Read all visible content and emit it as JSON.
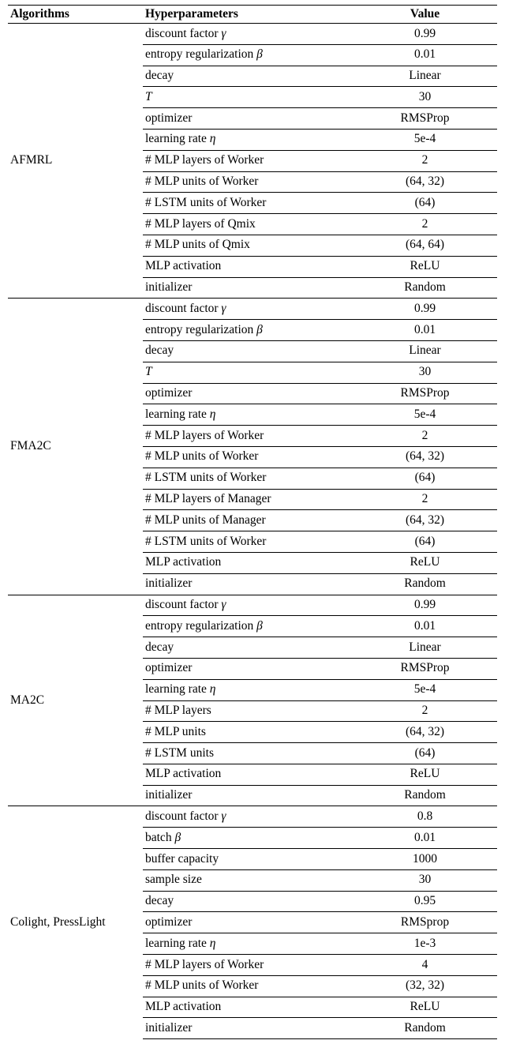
{
  "headers": {
    "alg": "Algorithms",
    "param": "Hyperparameters",
    "value": "Value"
  },
  "groups": [
    {
      "alg": "AFMRL",
      "rows": [
        {
          "param_html": "discount factor <span class='sym'>γ</span>",
          "value": "0.99"
        },
        {
          "param_html": "entropy regularization <span class='sym'>β</span>",
          "value": "0.01"
        },
        {
          "param_html": "decay",
          "value": "Linear"
        },
        {
          "param_html": "<span class='sym'>T</span>",
          "value": "30"
        },
        {
          "param_html": "optimizer",
          "value": "RMSProp"
        },
        {
          "param_html": "learning rate <span class='sym'>η</span>",
          "value": "5e-4"
        },
        {
          "param_html": "# MLP layers of Worker",
          "value": "2"
        },
        {
          "param_html": "# MLP units of Worker",
          "value": "(64, 32)"
        },
        {
          "param_html": "# LSTM units of Worker",
          "value": "(64)"
        },
        {
          "param_html": "# MLP layers of Qmix",
          "value": "2"
        },
        {
          "param_html": "# MLP units of Qmix",
          "value": "(64, 64)"
        },
        {
          "param_html": "MLP activation",
          "value": "ReLU"
        },
        {
          "param_html": "initializer",
          "value": "Random"
        }
      ]
    },
    {
      "alg": "FMA2C",
      "rows": [
        {
          "param_html": "discount factor <span class='sym'>γ</span>",
          "value": "0.99"
        },
        {
          "param_html": "entropy regularization <span class='sym'>β</span>",
          "value": "0.01"
        },
        {
          "param_html": "decay",
          "value": "Linear"
        },
        {
          "param_html": "<span class='sym'>T</span>",
          "value": "30"
        },
        {
          "param_html": "optimizer",
          "value": "RMSProp"
        },
        {
          "param_html": "learning rate <span class='sym'>η</span>",
          "value": "5e-4"
        },
        {
          "param_html": "# MLP layers of Worker",
          "value": "2"
        },
        {
          "param_html": "# MLP units of Worker",
          "value": "(64, 32)"
        },
        {
          "param_html": "# LSTM units of Worker",
          "value": "(64)"
        },
        {
          "param_html": "# MLP layers of Manager",
          "value": "2"
        },
        {
          "param_html": "# MLP units of Manager",
          "value": "(64, 32)"
        },
        {
          "param_html": "# LSTM units of Worker",
          "value": "(64)"
        },
        {
          "param_html": "MLP activation",
          "value": "ReLU"
        },
        {
          "param_html": "initializer",
          "value": "Random"
        }
      ]
    },
    {
      "alg": "MA2C",
      "rows": [
        {
          "param_html": "discount factor <span class='sym'>γ</span>",
          "value": "0.99"
        },
        {
          "param_html": "entropy regularization <span class='sym'>β</span>",
          "value": "0.01"
        },
        {
          "param_html": "decay",
          "value": "Linear"
        },
        {
          "param_html": "optimizer",
          "value": "RMSProp"
        },
        {
          "param_html": "learning rate <span class='sym'>η</span>",
          "value": "5e-4"
        },
        {
          "param_html": "# MLP layers",
          "value": "2"
        },
        {
          "param_html": "# MLP units",
          "value": "(64, 32)"
        },
        {
          "param_html": "# LSTM units",
          "value": "(64)"
        },
        {
          "param_html": "MLP activation",
          "value": "ReLU"
        },
        {
          "param_html": "initializer",
          "value": "Random"
        }
      ]
    },
    {
      "alg": "Colight, PressLight",
      "rows": [
        {
          "param_html": "discount factor <span class='sym'>γ</span>",
          "value": "0.8"
        },
        {
          "param_html": "batch <span class='sym'>β</span>",
          "value": "0.01"
        },
        {
          "param_html": "buffer capacity",
          "value": "1000"
        },
        {
          "param_html": "sample size",
          "value": "30"
        },
        {
          "param_html": "decay",
          "value": "0.95"
        },
        {
          "param_html": "optimizer",
          "value": "RMSprop"
        },
        {
          "param_html": "learning rate <span class='sym'>η</span>",
          "value": "1e-3"
        },
        {
          "param_html": "# MLP layers of Worker",
          "value": "4"
        },
        {
          "param_html": "# MLP units of Worker",
          "value": "(32, 32)"
        },
        {
          "param_html": "MLP activation",
          "value": "ReLU"
        },
        {
          "param_html": "initializer",
          "value": "Random"
        }
      ]
    }
  ]
}
